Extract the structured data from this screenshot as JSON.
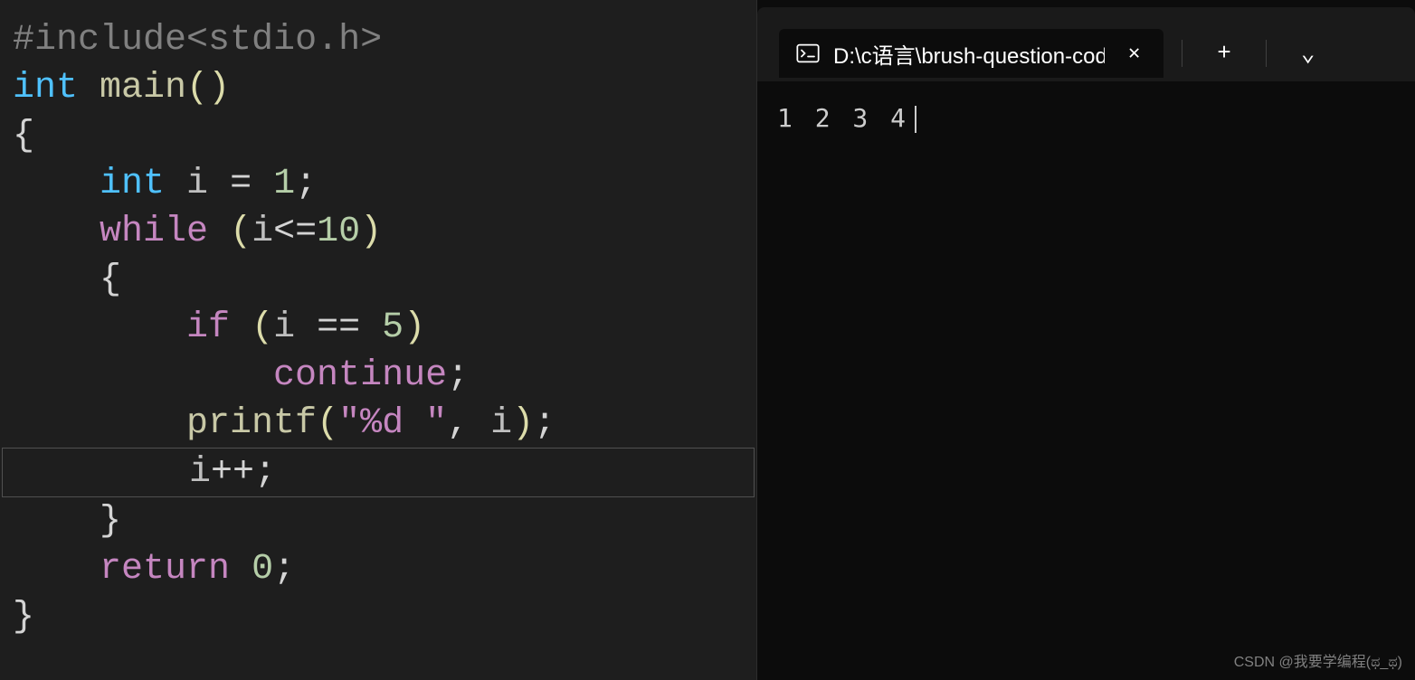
{
  "editor": {
    "code_tokens": {
      "line1_include": "#include",
      "line1_lt": "<",
      "line1_header": "stdio.h",
      "line1_gt": ">",
      "line2_type": "int",
      "line2_func": "main",
      "line2_lparen": "(",
      "line2_rparen": ")",
      "line3_brace": "{",
      "line4_type": "int",
      "line4_var": "i",
      "line4_eq": "=",
      "line4_val": "1",
      "line4_semi": ";",
      "line5_while": "while",
      "line5_lparen": "(",
      "line5_var": "i",
      "line5_op": "<=",
      "line5_val": "10",
      "line5_rparen": ")",
      "line6_brace": "{",
      "line7_if": "if",
      "line7_lparen": "(",
      "line7_var": "i",
      "line7_op": "==",
      "line7_val": "5",
      "line7_rparen": ")",
      "line8_continue": "continue",
      "line8_semi": ";",
      "line9_func": "printf",
      "line9_lparen": "(",
      "line9_str": "\"%d \"",
      "line9_comma": ",",
      "line9_var": "i",
      "line9_rparen": ")",
      "line9_semi": ";",
      "line10_var": "i",
      "line10_op": "++",
      "line10_semi": ";",
      "line11_brace": "}",
      "line12_return": "return",
      "line12_val": "0",
      "line12_semi": ";",
      "line13_brace": "}"
    }
  },
  "terminal": {
    "tab_title": "D:\\c语言\\brush-question-cod",
    "output": "1 2 3 4",
    "new_tab": "+",
    "dropdown": "⌄"
  },
  "watermark": "CSDN @我要学编程(ಥ_ಥ)"
}
